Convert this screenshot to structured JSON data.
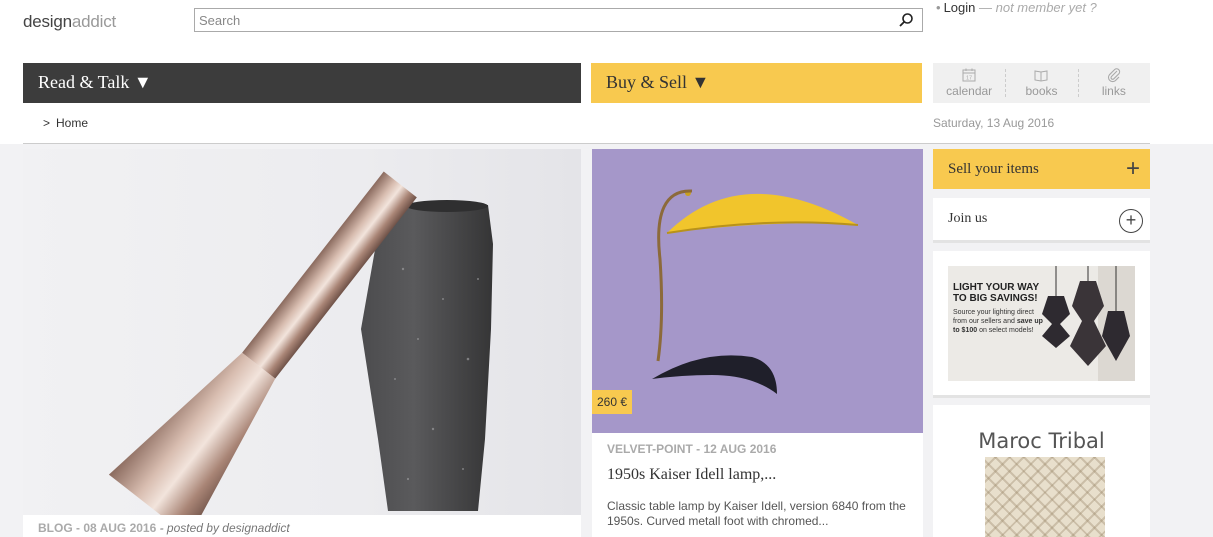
{
  "logo": {
    "part1": "design",
    "part2": "addict"
  },
  "search": {
    "placeholder": "Search"
  },
  "account": {
    "login": "Login",
    "separator": "—",
    "not_member": "not member yet ?"
  },
  "nav": {
    "read_talk": "Read & Talk ▼",
    "buy_sell": "Buy & Sell ▼"
  },
  "quick_links": [
    {
      "label": "calendar",
      "icon": "calendar-icon"
    },
    {
      "label": "books",
      "icon": "book-icon"
    },
    {
      "label": "links",
      "icon": "paperclip-icon"
    }
  ],
  "breadcrumb": {
    "arrow": ">",
    "home": "Home"
  },
  "date": "Saturday, 13 Aug 2016",
  "feature_post": {
    "category_date": "BLOG - 08 AUG 2016",
    "posted_by": " - posted by designaddict"
  },
  "listing": {
    "price": "260 €",
    "source_date": "VELVET-POINT - 12 AUG 2016",
    "title": "1950s Kaiser Idell lamp,...",
    "description": "Classic table lamp by Kaiser Idell, version 6840 from the 1950s. Curved metall foot with chromed..."
  },
  "sidebar": {
    "sell": "Sell your items",
    "sell_icon": "+",
    "join": "Join us",
    "join_icon": "+",
    "ad_lighting": {
      "headline": "LIGHT YOUR WAY TO BIG SAVINGS!",
      "line1": "Source your lighting direct from our sellers and ",
      "line1_bold": "save up to $100",
      "line2": " on select models!"
    },
    "ad_maroc": {
      "title": "Maroc Tribal"
    }
  },
  "colors": {
    "dark_nav": "#3c3c3c",
    "accent_yellow": "#f8c94f",
    "lamp_bg": "#a597c9"
  }
}
